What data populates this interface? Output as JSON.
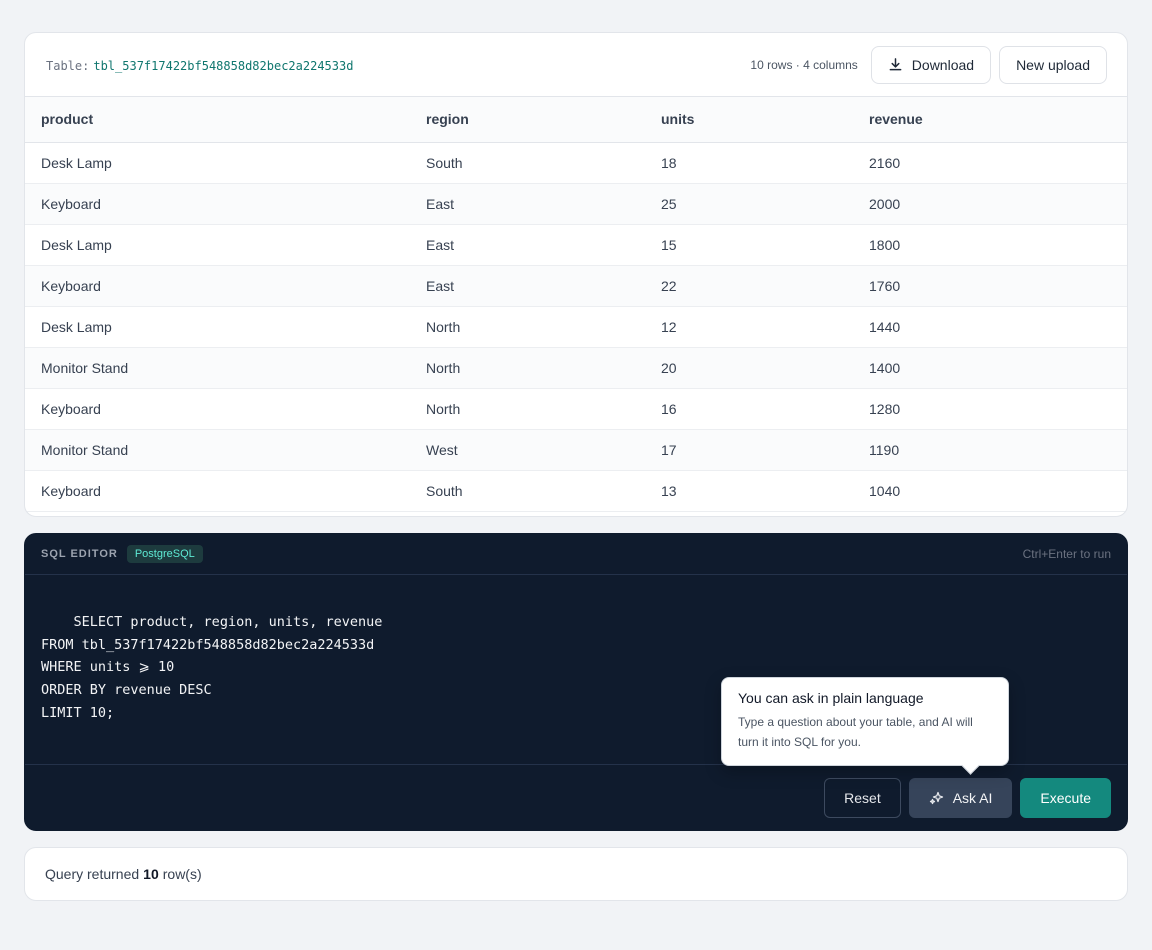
{
  "table_card": {
    "table_prefix": "Table:",
    "table_name": "tbl_537f17422bf548858d82bec2a224533d",
    "meta": "10 rows · 4 columns",
    "download_label": "Download",
    "new_upload_label": "New upload",
    "columns": [
      "product",
      "region",
      "units",
      "revenue"
    ],
    "rows": [
      [
        "Desk Lamp",
        "South",
        "18",
        "2160"
      ],
      [
        "Keyboard",
        "East",
        "25",
        "2000"
      ],
      [
        "Desk Lamp",
        "East",
        "15",
        "1800"
      ],
      [
        "Keyboard",
        "East",
        "22",
        "1760"
      ],
      [
        "Desk Lamp",
        "North",
        "12",
        "1440"
      ],
      [
        "Monitor Stand",
        "North",
        "20",
        "1400"
      ],
      [
        "Keyboard",
        "North",
        "16",
        "1280"
      ],
      [
        "Monitor Stand",
        "West",
        "17",
        "1190"
      ],
      [
        "Keyboard",
        "South",
        "13",
        "1040"
      ]
    ]
  },
  "editor": {
    "label": "SQL EDITOR",
    "dialect": "PostgreSQL",
    "shortcut_hint": "Ctrl+Enter to run",
    "query": "SELECT product, region, units, revenue\nFROM tbl_537f17422bf548858d82bec2a224533d\nWHERE units ⩾ 10\nORDER BY revenue DESC\nLIMIT 10;",
    "reset_label": "Reset",
    "ask_ai_label": "Ask AI",
    "execute_label": "Execute"
  },
  "tooltip": {
    "title": "You can ask in plain language",
    "body": "Type a question about your table, and AI will turn it into SQL for you."
  },
  "status": {
    "prefix": "Query returned",
    "count": "10",
    "suffix": "row(s)"
  },
  "colors": {
    "accent": "#14897e",
    "editor_bg": "#0f1b2d",
    "table_name": "#0f766e"
  },
  "icons": {
    "download": "download-icon",
    "ask_ai": "sparkle-icon"
  }
}
